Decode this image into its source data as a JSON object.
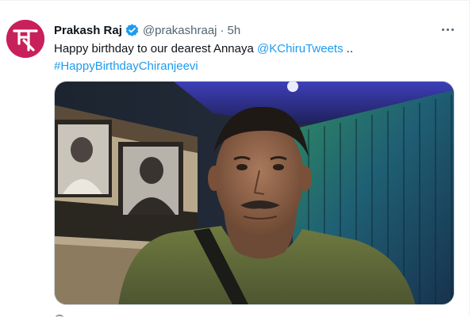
{
  "tweet": {
    "author_name": "Prakash Raj",
    "handle": "@prakashraaj",
    "separator": "·",
    "time": "5h",
    "text_prefix": "Happy birthday to our dearest Annaya ",
    "mention": "@KChiruTweets",
    "text_suffix": " ..",
    "hashtag": "#HappyBirthdayChiranjeevi",
    "verified": true,
    "icons": {
      "verified": "verified-badge-icon",
      "more": "more-options-icon",
      "avatar": "avatar-logo"
    },
    "colors": {
      "link": "#1d9bf0",
      "verified": "#1d9bf0",
      "avatar_bg": "#c8205a"
    }
  }
}
